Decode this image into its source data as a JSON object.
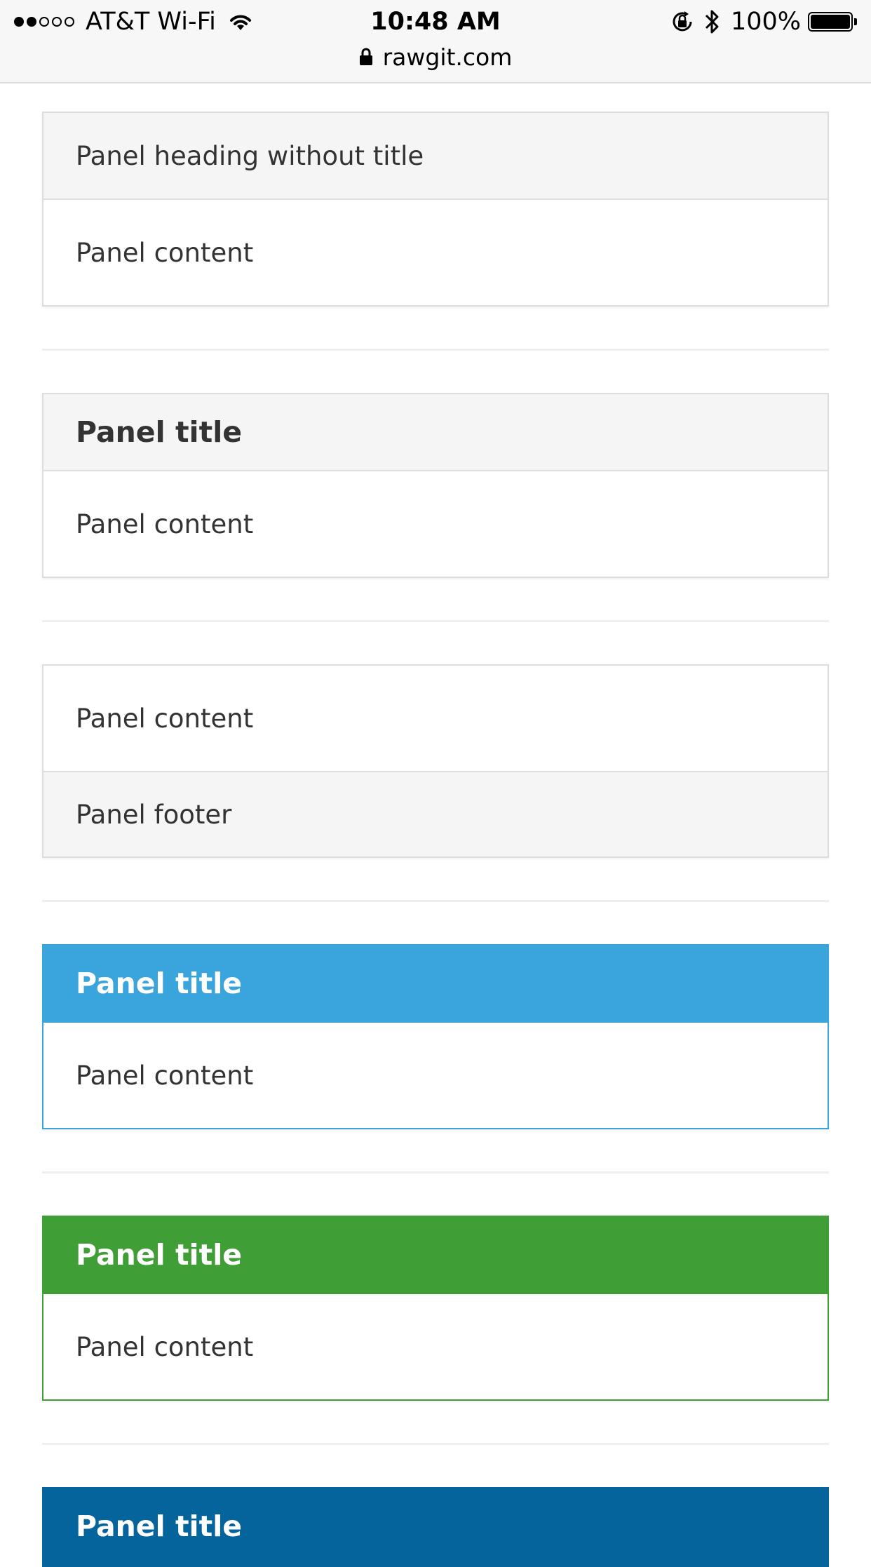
{
  "status_bar": {
    "signal_dots": [
      "full",
      "full",
      "empty",
      "empty",
      "empty"
    ],
    "carrier": "AT&T Wi-Fi",
    "time": "10:48 AM",
    "battery_percent": "100%",
    "icons": [
      "wifi-icon",
      "orientation-lock-icon",
      "bluetooth-icon",
      "battery-icon"
    ]
  },
  "url_bar": {
    "icon": "padlock-icon",
    "domain": "rawgit.com"
  },
  "colors": {
    "primary": "#3aa5dc",
    "success": "#409e36",
    "info": "#05649c",
    "panel_border": "#dddddd",
    "heading_bg": "#f5f5f5"
  },
  "panels": {
    "heading_no_title": {
      "heading": "Panel heading without title",
      "body": "Panel content"
    },
    "heading_with_title": {
      "title": "Panel title",
      "body": "Panel content"
    },
    "with_footer": {
      "body": "Panel content",
      "footer": "Panel footer"
    },
    "primary": {
      "title": "Panel title",
      "body": "Panel content"
    },
    "success": {
      "title": "Panel title",
      "body": "Panel content"
    },
    "info": {
      "title": "Panel title"
    }
  }
}
